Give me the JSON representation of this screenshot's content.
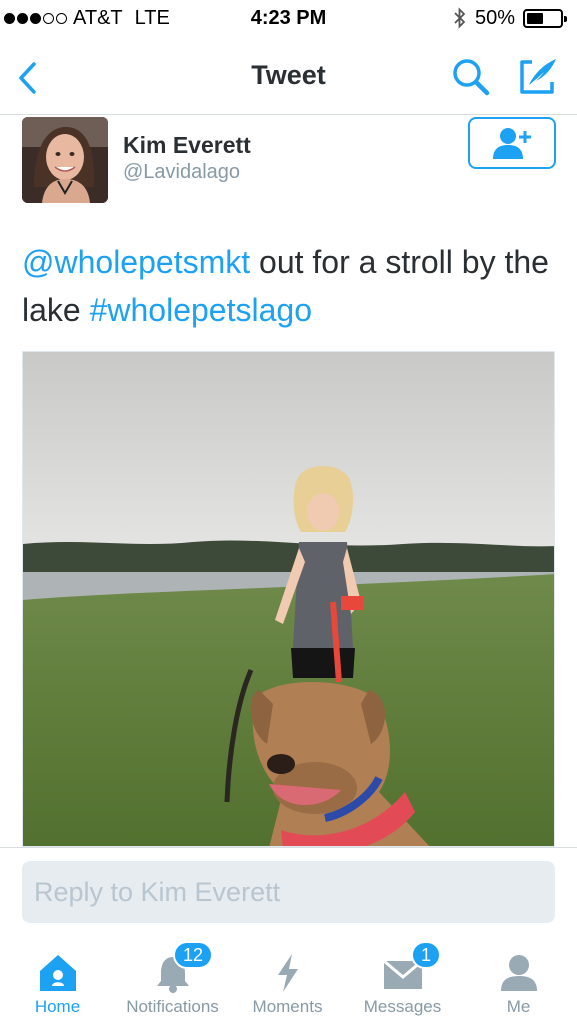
{
  "status_bar": {
    "carrier": "AT&T",
    "network": "LTE",
    "time": "4:23 PM",
    "battery": "50%",
    "battery_level": 0.5,
    "signal_bars": 3
  },
  "nav": {
    "title": "Tweet",
    "accent_color": "#1da1f2"
  },
  "author": {
    "name": "Kim Everett",
    "handle": "@Lavidalago"
  },
  "tweet": {
    "mention": "@wholepetsmkt",
    "text": " out for a stroll by the lake ",
    "hashtag": "#wholepetslago"
  },
  "reply": {
    "placeholder": "Reply to Kim Everett"
  },
  "tabs": [
    {
      "label": "Home",
      "icon": "home-icon",
      "active": true
    },
    {
      "label": "Notifications",
      "icon": "bell-icon",
      "badge": "12"
    },
    {
      "label": "Moments",
      "icon": "lightning-icon"
    },
    {
      "label": "Messages",
      "icon": "envelope-icon",
      "badge": "1"
    },
    {
      "label": "Me",
      "icon": "person-icon"
    }
  ]
}
